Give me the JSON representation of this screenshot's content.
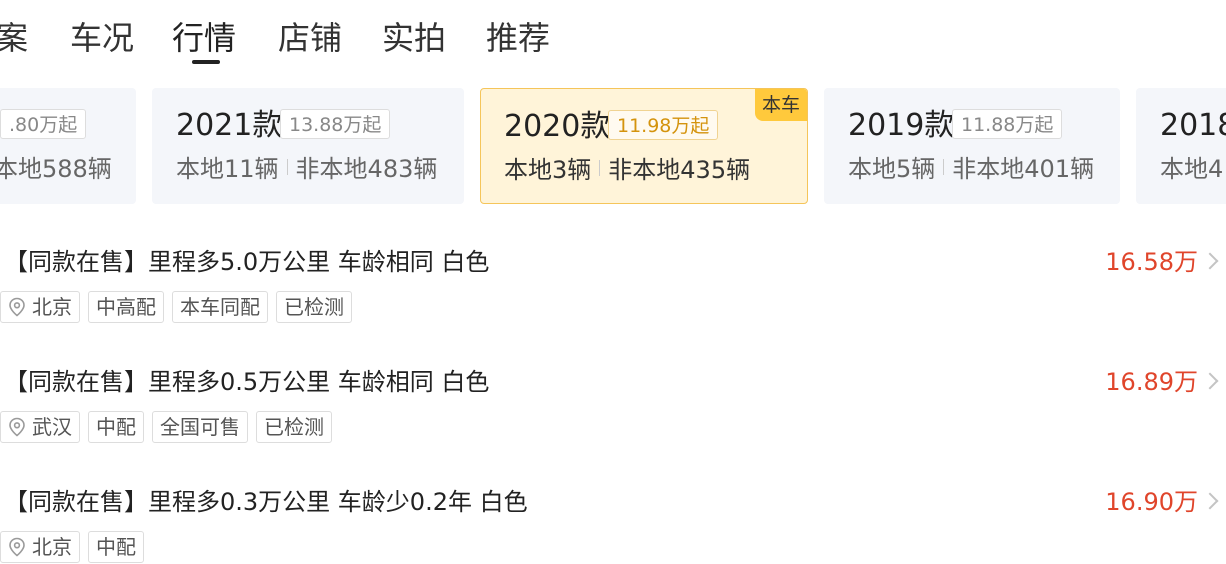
{
  "tabs": [
    {
      "label": "案",
      "active": false
    },
    {
      "label": "车况",
      "active": false
    },
    {
      "label": "行情",
      "active": true
    },
    {
      "label": "店铺",
      "active": false
    },
    {
      "label": "实拍",
      "active": false
    },
    {
      "label": "推荐",
      "active": false
    }
  ],
  "year_cards": [
    {
      "year": "",
      "price": ".80万起",
      "local": "本地588辆",
      "nonlocal": ""
    },
    {
      "year": "2021款",
      "price": "13.88万起",
      "local": "本地11辆",
      "nonlocal": "非本地483辆"
    },
    {
      "year": "2020款",
      "price": "11.98万起",
      "local": "本地3辆",
      "nonlocal": "非本地435辆",
      "selected": true,
      "badge": "本车"
    },
    {
      "year": "2019款",
      "price": "11.88万起",
      "local": "本地5辆",
      "nonlocal": "非本地401辆"
    },
    {
      "year": "2018",
      "price": "",
      "local": "本地4",
      "nonlocal": ""
    }
  ],
  "listings": [
    {
      "title": "【同款在售】里程多5.0万公里 车龄相同 白色",
      "price": "16.58万",
      "city": "北京",
      "tags": [
        "中高配",
        "本车同配",
        "已检测"
      ]
    },
    {
      "title": "【同款在售】里程多0.5万公里 车龄相同 白色",
      "price": "16.89万",
      "city": "武汉",
      "tags": [
        "中配",
        "全国可售",
        "已检测"
      ]
    },
    {
      "title": "【同款在售】里程多0.3万公里 车龄少0.2年 白色",
      "price": "16.90万",
      "city": "北京",
      "tags": [
        "中配"
      ]
    }
  ],
  "icons": {
    "location": "location-pin-icon",
    "chevron": "chevron-right-icon"
  },
  "colors": {
    "price_red": "#e0452b",
    "selected_card_bg": "#fff4d9",
    "selected_card_border": "#f5c55a",
    "badge_bg": "#ffc93c",
    "selected_price_text": "#d4930d",
    "card_bg": "#f4f6fa"
  }
}
